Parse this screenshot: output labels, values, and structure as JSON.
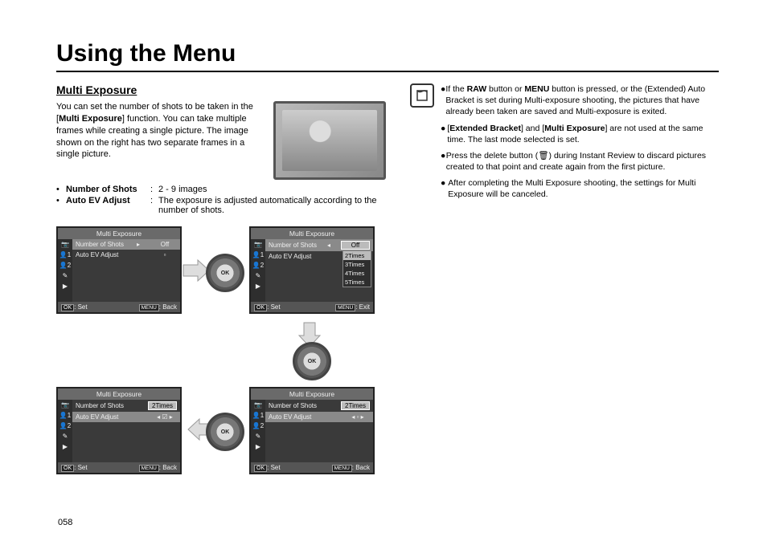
{
  "header": {
    "title": "Using the Menu"
  },
  "section": {
    "heading": "Multi Exposure"
  },
  "intro": {
    "p1a": "You can set the number of shots to be taken in the [",
    "p1b": "Multi Exposure",
    "p1c": "] function. You can take multiple frames while creating a single picture. The image shown on the right has two separate frames in a single picture."
  },
  "defs": {
    "shots_label": "Number of Shots",
    "shots_val": "2 - 9 images",
    "ev_label": "Auto EV Adjust",
    "ev_val": "The exposure is adjusted automatically according to the number of shots."
  },
  "screens": {
    "title": "Multi Exposure",
    "row_shots": "Number of Shots",
    "row_ev": "Auto EV Adjust",
    "off": "Off",
    "two": "2Times",
    "opts": [
      "2Times",
      "3Times",
      "4Times",
      "5Times"
    ],
    "set": ": Set",
    "back": ": Back",
    "exit": ": Exit",
    "ok": "OK",
    "menu": "MENU"
  },
  "side_icons": [
    "📷",
    "👤1",
    "👤2",
    "✎",
    "▶"
  ],
  "notes": {
    "n1a": "If the ",
    "n1b": "RAW",
    "n1c": " button or ",
    "n1d": "MENU",
    "n1e": " button is pressed, or the (Extended) Auto Bracket is set during Multi-exposure shooting, the pictures that have already been taken are saved and Multi-exposure is exited.",
    "n2a": "[",
    "n2b": "Extended Bracket",
    "n2c": "] and [",
    "n2d": "Multi Exposure",
    "n2e": "] are not used at the same time. The last mode selected is set.",
    "n3": "Press the delete button (🗑) during Instant Review to discard pictures created to that point and create again from the first picture.",
    "n4": "After completing the Multi Exposure shooting, the settings for Multi Exposure will be canceled."
  },
  "page_num": "058"
}
